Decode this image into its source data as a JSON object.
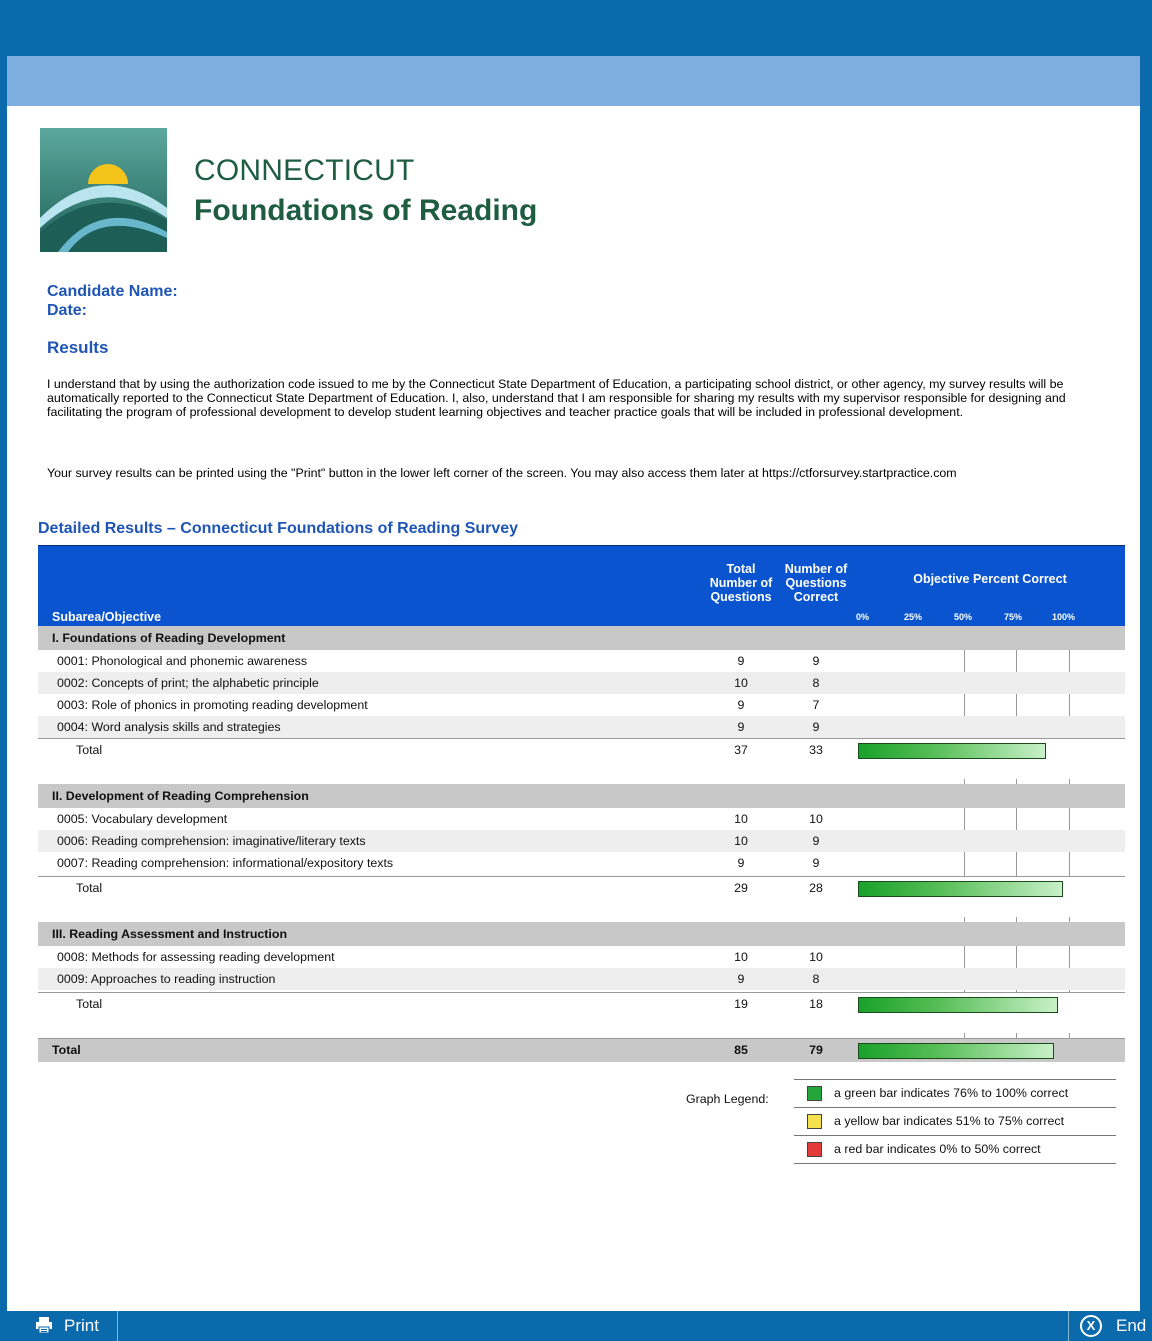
{
  "brand": {
    "line1": "CONNECTICUT",
    "line2": "Foundations of Reading"
  },
  "candidate": {
    "name_label": "Candidate Name:",
    "date_label": "Date:"
  },
  "results_heading": "Results",
  "paragraphs": [
    "I understand that by using the authorization code issued to me by the Connecticut State Department of Education, a participating school district, or other agency, my survey results will be automatically reported to the Connecticut State Department of Education. I, also, understand that I am responsible for sharing my results with my supervisor responsible for designing and facilitating the program of professional development to develop student learning objectives and teacher practice goals that will be included in professional development.",
    "Your survey results can be printed using the \"Print\" button in the lower left corner of the screen. You may also access them later at https://ctforsurvey.startpractice.com"
  ],
  "detail_heading": "Detailed Results – Connecticut Foundations of Reading Survey",
  "table": {
    "headers": {
      "subarea": "Subarea/Objective",
      "total": "Total Number of Questions",
      "correct": "Number of Questions Correct",
      "objective": "Objective Percent Correct",
      "ticks": [
        "0%",
        "25%",
        "50%",
        "75%",
        "100%"
      ]
    },
    "sections": [
      {
        "title": "I. Foundations of Reading Development",
        "rows": [
          {
            "name": "0001: Phonological and phonemic awareness",
            "total": "9",
            "correct": "9"
          },
          {
            "name": "0002: Concepts of print; the alphabetic principle",
            "total": "10",
            "correct": "8"
          },
          {
            "name": "0003: Role of phonics in promoting reading development",
            "total": "9",
            "correct": "7"
          },
          {
            "name": "0004: Word analysis skills and strategies",
            "total": "9",
            "correct": "9"
          }
        ],
        "total": {
          "label": "Total",
          "total": "37",
          "correct": "33",
          "percent": 89
        }
      },
      {
        "title": "II. Development of Reading Comprehension",
        "rows": [
          {
            "name": "0005: Vocabulary development",
            "total": "10",
            "correct": "10"
          },
          {
            "name": "0006: Reading comprehension: imaginative/literary texts",
            "total": "10",
            "correct": "9"
          },
          {
            "name": "0007: Reading comprehension: informational/expository texts",
            "total": "9",
            "correct": "9"
          }
        ],
        "total": {
          "label": "Total",
          "total": "29",
          "correct": "28",
          "percent": 97
        }
      },
      {
        "title": "III. Reading Assessment and Instruction",
        "rows": [
          {
            "name": "0008: Methods for assessing reading development",
            "total": "10",
            "correct": "10"
          },
          {
            "name": "0009: Approaches to reading instruction",
            "total": "9",
            "correct": "8"
          }
        ],
        "total": {
          "label": "Total",
          "total": "19",
          "correct": "18",
          "percent": 95
        }
      }
    ],
    "grand_total": {
      "label": "Total",
      "total": "85",
      "correct": "79",
      "percent": 93
    }
  },
  "legend": {
    "label": "Graph Legend:",
    "items": [
      {
        "color": "#22a63a",
        "text": "a green bar indicates 76% to 100% correct"
      },
      {
        "color": "#f5e050",
        "text": "a yellow bar indicates 51% to 75% correct"
      },
      {
        "color": "#e53a3a",
        "text": "a red bar indicates 0% to 50% correct"
      }
    ]
  },
  "footer": {
    "print_label": "Print",
    "end_label": "End",
    "print_icon": "printer-icon",
    "end_icon": "close-circle-icon"
  }
}
